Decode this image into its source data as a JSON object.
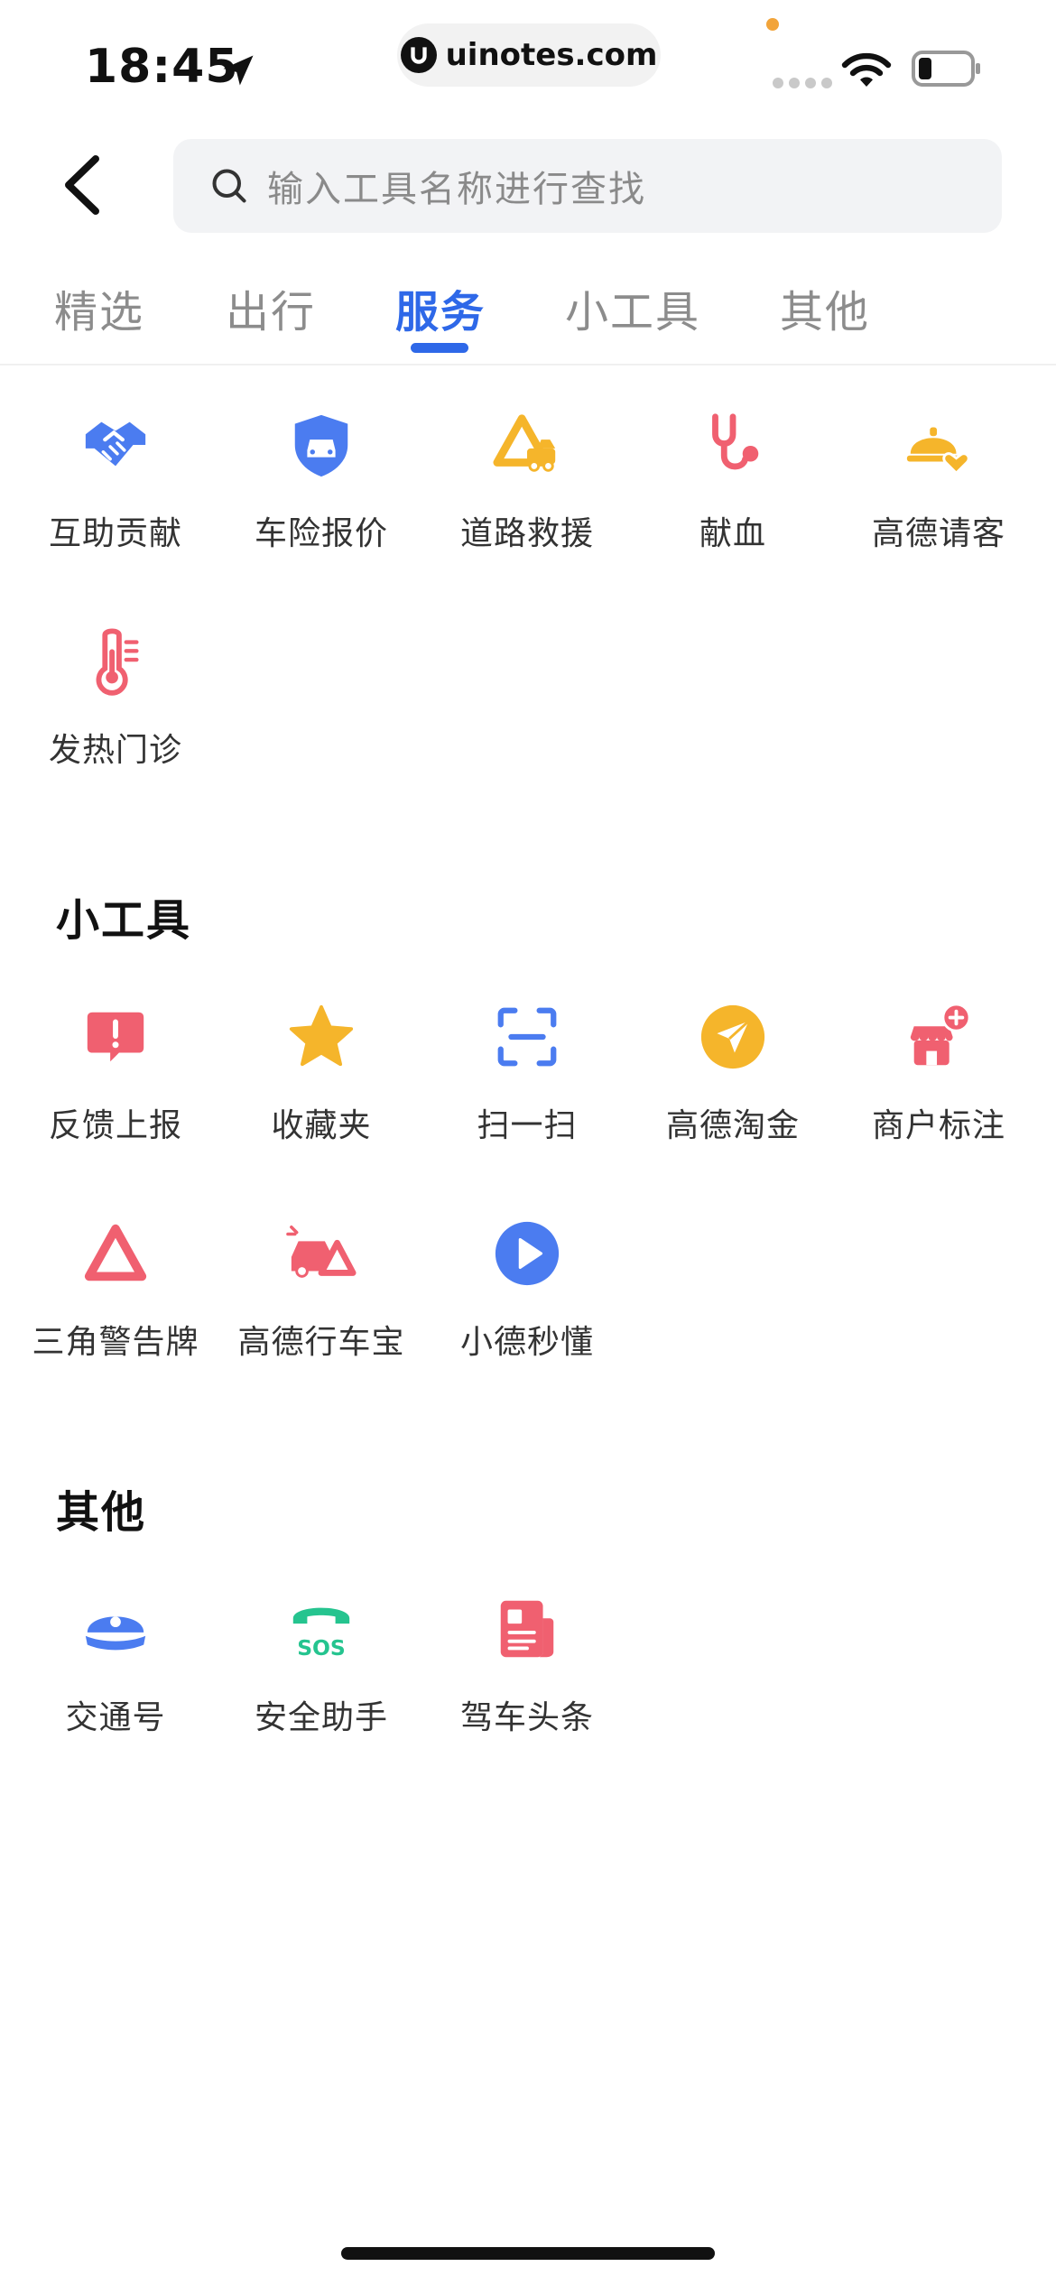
{
  "status_bar": {
    "time": "18:45",
    "url": "uinotes.com"
  },
  "search": {
    "placeholder": "输入工具名称进行查找"
  },
  "tabs": [
    {
      "label": "精选",
      "active": false
    },
    {
      "label": "出行",
      "active": false
    },
    {
      "label": "服务",
      "active": true
    },
    {
      "label": "小工具",
      "active": false
    },
    {
      "label": "其他",
      "active": false
    }
  ],
  "services": {
    "items": [
      {
        "label": "互助贡献",
        "icon": "handshake-icon",
        "color": "#4b7cf0"
      },
      {
        "label": "车险报价",
        "icon": "car-shield-icon",
        "color": "#4b7cf0"
      },
      {
        "label": "道路救援",
        "icon": "tow-truck-icon",
        "color": "#f5b52b"
      },
      {
        "label": "献血",
        "icon": "stethoscope-icon",
        "color": "#f06070"
      },
      {
        "label": "高德请客",
        "icon": "food-cloche-icon",
        "color": "#f5b52b"
      },
      {
        "label": "发热门诊",
        "icon": "thermometer-icon",
        "color": "#f06070"
      }
    ]
  },
  "tools": {
    "title": "小工具",
    "items": [
      {
        "label": "反馈上报",
        "icon": "feedback-icon",
        "color": "#f06070"
      },
      {
        "label": "收藏夹",
        "icon": "star-icon",
        "color": "#f5b52b"
      },
      {
        "label": "扫一扫",
        "icon": "scan-icon",
        "color": "#4b7cf0"
      },
      {
        "label": "高德淘金",
        "icon": "paper-plane-icon",
        "color": "#f5b52b"
      },
      {
        "label": "商户标注",
        "icon": "shop-add-icon",
        "color": "#f06070"
      },
      {
        "label": "三角警告牌",
        "icon": "warning-triangle-icon",
        "color": "#f06070"
      },
      {
        "label": "高德行车宝",
        "icon": "car-warning-icon",
        "color": "#f06070"
      },
      {
        "label": "小德秒懂",
        "icon": "play-icon",
        "color": "#4b7cf0"
      }
    ]
  },
  "others": {
    "title": "其他",
    "items": [
      {
        "label": "交通号",
        "icon": "police-cap-icon",
        "color": "#4b7cf0"
      },
      {
        "label": "安全助手",
        "icon": "sos-phone-icon",
        "color": "#25c48f",
        "icon_text": "SOS"
      },
      {
        "label": "驾车头条",
        "icon": "newspaper-icon",
        "color": "#f06070"
      }
    ]
  }
}
